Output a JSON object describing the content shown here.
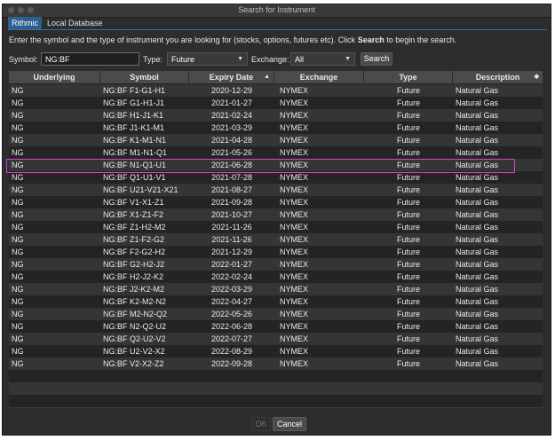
{
  "window": {
    "title": "Search for Instrument"
  },
  "tabs": [
    {
      "label": "Rithmic",
      "active": true
    },
    {
      "label": "Local Database",
      "active": false
    }
  ],
  "instruction": {
    "prefix": "Enter the symbol and the type of instrument you are looking for (stocks, options, futures etc).  Click ",
    "bold": "Search",
    "suffix": " to begin the search."
  },
  "search": {
    "symbol_label": "Symbol:",
    "symbol_value": "NG:BF",
    "type_label": "Type:",
    "type_value": "Future",
    "exchange_label": "Exchange:",
    "exchange_value": "All",
    "search_button": "Search"
  },
  "table": {
    "columns": [
      "Underlying",
      "Symbol",
      "Expiry Date",
      "Exchange",
      "Type",
      "Description"
    ],
    "sort_column": "Expiry Date",
    "sort_indicator": "▲",
    "rows": [
      [
        "NG",
        "NG:BF F1-G1-H1",
        "2020-12-29",
        "NYMEX",
        "Future",
        "Natural Gas"
      ],
      [
        "NG",
        "NG:BF G1-H1-J1",
        "2021-01-27",
        "NYMEX",
        "Future",
        "Natural Gas"
      ],
      [
        "NG",
        "NG:BF H1-J1-K1",
        "2021-02-24",
        "NYMEX",
        "Future",
        "Natural Gas"
      ],
      [
        "NG",
        "NG:BF J1-K1-M1",
        "2021-03-29",
        "NYMEX",
        "Future",
        "Natural Gas"
      ],
      [
        "NG",
        "NG:BF K1-M1-N1",
        "2021-04-28",
        "NYMEX",
        "Future",
        "Natural Gas"
      ],
      [
        "NG",
        "NG:BF M1-N1-Q1",
        "2021-05-26",
        "NYMEX",
        "Future",
        "Natural Gas"
      ],
      [
        "NG",
        "NG:BF N1-Q1-U1",
        "2021-06-28",
        "NYMEX",
        "Future",
        "Natural Gas"
      ],
      [
        "NG",
        "NG:BF Q1-U1-V1",
        "2021-07-28",
        "NYMEX",
        "Future",
        "Natural Gas"
      ],
      [
        "NG",
        "NG:BF U21-V21-X21",
        "2021-08-27",
        "NYMEX",
        "Future",
        "Natural Gas"
      ],
      [
        "NG",
        "NG:BF V1-X1-Z1",
        "2021-09-28",
        "NYMEX",
        "Future",
        "Natural Gas"
      ],
      [
        "NG",
        "NG:BF X1-Z1-F2",
        "2021-10-27",
        "NYMEX",
        "Future",
        "Natural Gas"
      ],
      [
        "NG",
        "NG:BF Z1-H2-M2",
        "2021-11-26",
        "NYMEX",
        "Future",
        "Natural Gas"
      ],
      [
        "NG",
        "NG:BF Z1-F2-G2",
        "2021-11-26",
        "NYMEX",
        "Future",
        "Natural Gas"
      ],
      [
        "NG",
        "NG:BF F2-G2-H2",
        "2021-12-29",
        "NYMEX",
        "Future",
        "Natural Gas"
      ],
      [
        "NG",
        "NG:BF G2-H2-J2",
        "2022-01-27",
        "NYMEX",
        "Future",
        "Natural Gas"
      ],
      [
        "NG",
        "NG:BF H2-J2-K2",
        "2022-02-24",
        "NYMEX",
        "Future",
        "Natural Gas"
      ],
      [
        "NG",
        "NG:BF J2-K2-M2",
        "2022-03-29",
        "NYMEX",
        "Future",
        "Natural Gas"
      ],
      [
        "NG",
        "NG:BF K2-M2-N2",
        "2022-04-27",
        "NYMEX",
        "Future",
        "Natural Gas"
      ],
      [
        "NG",
        "NG:BF M2-N2-Q2",
        "2022-05-26",
        "NYMEX",
        "Future",
        "Natural Gas"
      ],
      [
        "NG",
        "NG:BF N2-Q2-U2",
        "2022-06-28",
        "NYMEX",
        "Future",
        "Natural Gas"
      ],
      [
        "NG",
        "NG:BF Q2-U2-V2",
        "2022-07-27",
        "NYMEX",
        "Future",
        "Natural Gas"
      ],
      [
        "NG",
        "NG:BF U2-V2-X2",
        "2022-08-29",
        "NYMEX",
        "Future",
        "Natural Gas"
      ],
      [
        "NG",
        "NG:BF V2-X2-Z2",
        "2022-09-28",
        "NYMEX",
        "Future",
        "Natural Gas"
      ]
    ],
    "highlighted_row": 6
  },
  "footer": {
    "ok_label": "OK",
    "cancel_label": "Cancel"
  },
  "colors": {
    "highlight": "#d63fd6",
    "tab_active": "#2c5f8f"
  }
}
